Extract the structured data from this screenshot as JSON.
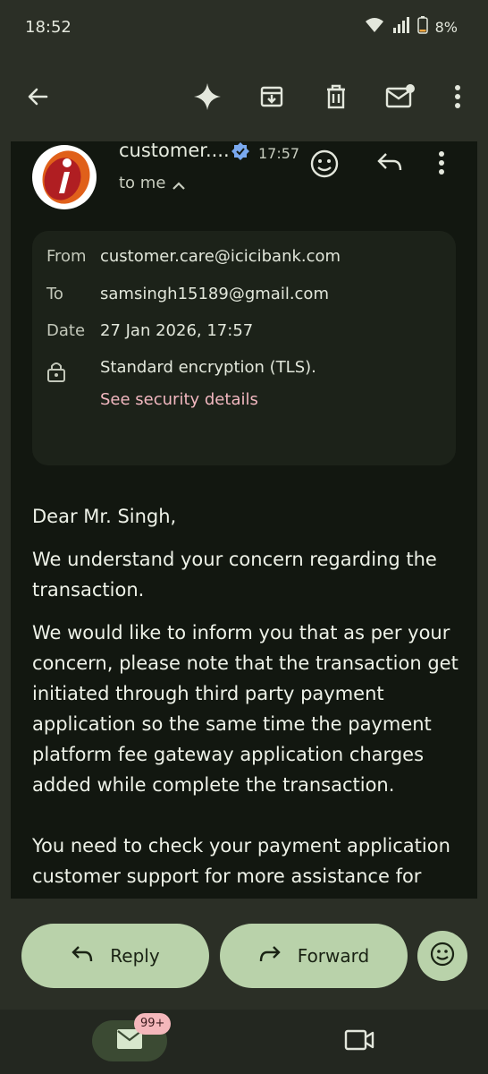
{
  "status_bar": {
    "time": "18:52",
    "battery": "8%"
  },
  "email": {
    "sender": "customer....",
    "time": "17:57",
    "to_me": "to me",
    "details": {
      "from_label": "From",
      "from_value": "customer.care@icicibank.com",
      "to_label": "To",
      "to_value": "samsingh15189@gmail.com",
      "date_label": "Date",
      "date_value": "27 Jan 2026, 17:57",
      "encryption": "Standard encryption (TLS).",
      "security_link": "See security details"
    },
    "body": {
      "greeting": "Dear Mr. Singh,",
      "p1": "We understand your concern regarding the transaction.",
      "p2": "We would like to inform you that as per your concern, please note that the transaction get initiated through third  party payment application so the same time the payment platform fee gateway application charges added while complete the transaction.",
      "p3": "You need to check your payment application customer support for more assistance for"
    }
  },
  "actions": {
    "reply_label": "Reply",
    "forward_label": "Forward"
  },
  "bottom_nav": {
    "mail_badge": "99+"
  },
  "icons": [
    "back-arrow-icon",
    "sparkle-icon",
    "archive-icon",
    "delete-icon",
    "mark-unread-icon",
    "more-vert-icon",
    "verified-icon",
    "chevron-up-icon",
    "emoji-icon",
    "reply-icon",
    "lock-icon",
    "forward-icon",
    "mail-icon",
    "video-icon"
  ],
  "colors": {
    "background": "#2b2f26",
    "panel": "#121710",
    "accent_pill": "#b9d2aa",
    "link": "#f2b8c0",
    "badge": "#f4b7bb"
  }
}
